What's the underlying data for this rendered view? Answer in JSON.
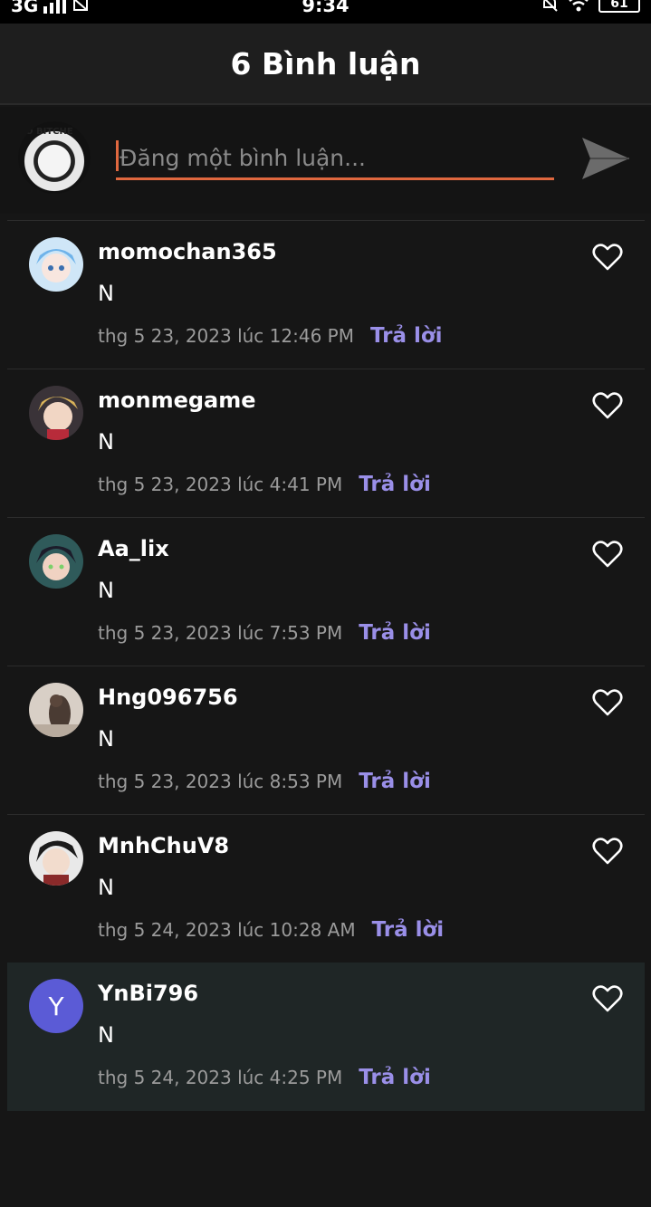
{
  "status_bar": {
    "network": "3G",
    "time": "9:34",
    "battery": "61"
  },
  "header": {
    "title": "6 Bình luận"
  },
  "composer": {
    "placeholder": "Đăng một bình luận...",
    "avatar_text": "O BITCHE"
  },
  "colors": {
    "accent": "#e0683f",
    "reply": "#9a8fe8",
    "highlight_bg": "#1f2626",
    "avatar_letter_bg": "#5b5bd6"
  },
  "reply_label": "Trả lời",
  "comments": [
    {
      "username": "momochan365",
      "text": "N",
      "timestamp": "thg 5 23, 2023 lúc 12:46 PM",
      "avatar_icon": "anime-avatar-blue-hair"
    },
    {
      "username": "monmegame",
      "text": "N",
      "timestamp": "thg 5 23, 2023 lúc 4:41 PM",
      "avatar_icon": "anime-avatar-blonde"
    },
    {
      "username": "Aa_lix",
      "text": "N",
      "timestamp": "thg 5 23, 2023 lúc 7:53 PM",
      "avatar_icon": "anime-avatar-dark-hair"
    },
    {
      "username": "Hng096756",
      "text": "N",
      "timestamp": "thg 5 23, 2023 lúc 8:53 PM",
      "avatar_icon": "photo-avatar"
    },
    {
      "username": "MnhChuV8",
      "text": "N",
      "timestamp": "thg 5 24, 2023 lúc 10:28 AM",
      "avatar_icon": "anime-avatar-swordsman"
    },
    {
      "username": "YnBi796",
      "text": "N",
      "timestamp": "thg 5 24, 2023 lúc 4:25 PM",
      "avatar_letter": "Y"
    }
  ]
}
